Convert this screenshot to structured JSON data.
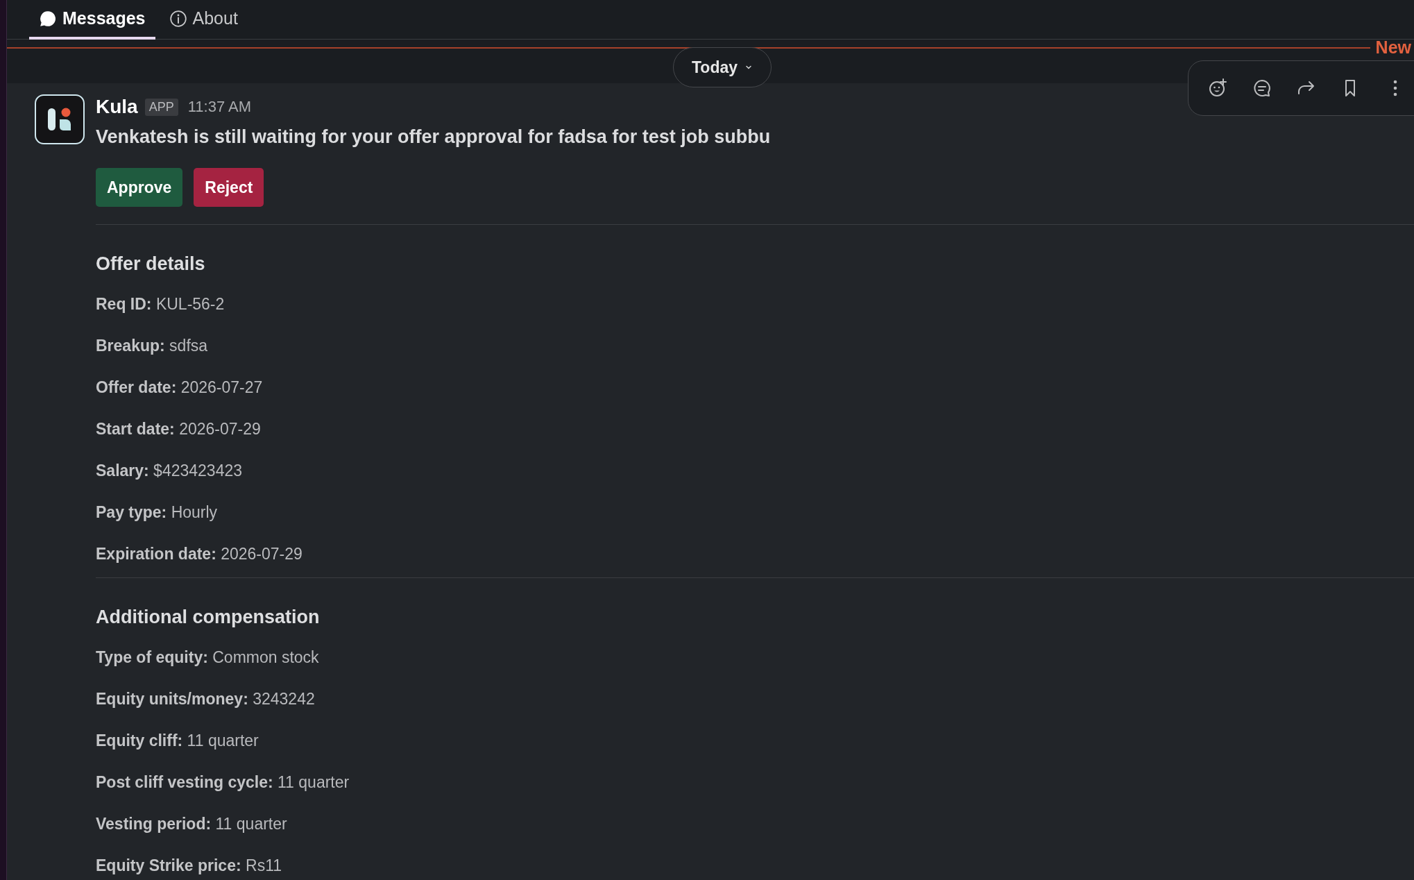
{
  "tabs": [
    {
      "label": "Messages",
      "selected": true
    },
    {
      "label": "About",
      "selected": false
    }
  ],
  "new_divider": {
    "label": "New"
  },
  "date_pill": {
    "label": "Today"
  },
  "message": {
    "sender": "Kula",
    "badge": "APP",
    "time": "11:37 AM",
    "text": "Venkatesh is still waiting for your offer approval for fadsa for test job subbu",
    "buttons": [
      {
        "label": "Approve",
        "kind": "primary"
      },
      {
        "label": "Reject",
        "kind": "danger"
      }
    ],
    "sections": [
      {
        "title": "Offer details",
        "fields": [
          "**Req ID:** KUL-56-2",
          "**Breakup:** sdfsa",
          "**Offer date:** 2026-07-27",
          "**Start date:** 2026-07-29",
          "**Salary:** $423423423",
          "**Pay type:** Hourly",
          "**Expiration date:** 2026-07-29"
        ]
      },
      {
        "title": "Additional compensation",
        "fields": [
          "**Type of equity:** Common stock",
          "**Equity units/money:** 3243242",
          "**Equity cliff:** 11 quarter",
          "**Post cliff vesting cycle:** 11 quarter",
          "**Vesting period:** 11 quarter",
          "**Equity Strike price:** Rs11"
        ]
      }
    ]
  }
}
